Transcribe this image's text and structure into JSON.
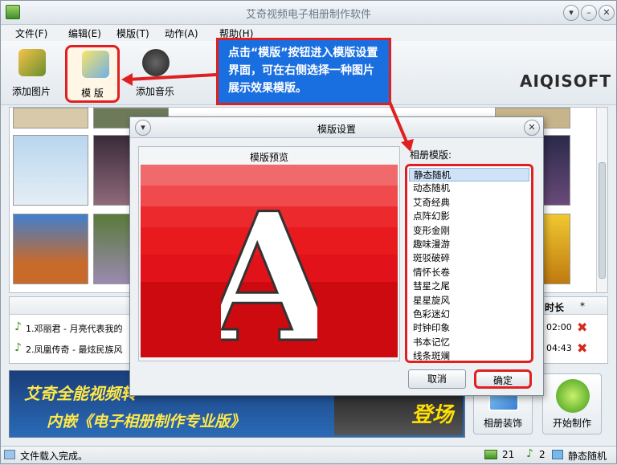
{
  "window": {
    "title": "艾奇视频电子相册制作软件"
  },
  "menu": [
    "文件(F)",
    "编辑(E)",
    "模版(T)",
    "动作(A)",
    "帮助(H)"
  ],
  "toolbar": {
    "add_image": "添加图片",
    "template": "模 版",
    "add_music": "添加音乐"
  },
  "logo_text": "AIQISOFT",
  "music": {
    "col_duration": "时长",
    "col_delete": "*",
    "rows": [
      {
        "title": "1.邓丽君 - 月亮代表我的",
        "duration": "02:00"
      },
      {
        "title": "2.凤凰传奇 - 最炫民族风",
        "duration": "04:43"
      }
    ]
  },
  "banner": {
    "line1": "艾奇全能视频转",
    "line2": "内嵌《电子相册制作专业版》",
    "promo": "登场"
  },
  "actions": {
    "decorate": "相册装饰",
    "start": "开始制作"
  },
  "status": {
    "message": "文件载入完成。",
    "images": "21",
    "music": "2",
    "template": "静态随机"
  },
  "dialog": {
    "title": "模版设置",
    "preview_label": "模版预览",
    "preview_letter": "A",
    "list_label": "相册模版:",
    "templates": [
      "静态随机",
      "动态随机",
      "艾奇经典",
      "点阵幻影",
      "变形金刚",
      "趣味漫游",
      "斑驳破碎",
      "情怀长卷",
      "彗星之尾",
      "星星旋风",
      "色彩迷幻",
      "时钟印象",
      "书本记忆",
      "线条斑斓"
    ],
    "selected": "静态随机",
    "cancel": "取消",
    "ok": "确定"
  },
  "callout": {
    "text": "点击“模版”按钮进入模版设置界面，可在右侧选择一种图片展示效果模版。"
  },
  "colors": {
    "highlight": "#e02020",
    "callout_bg": "#1a6fe0",
    "preview_red": "#e9161c"
  }
}
